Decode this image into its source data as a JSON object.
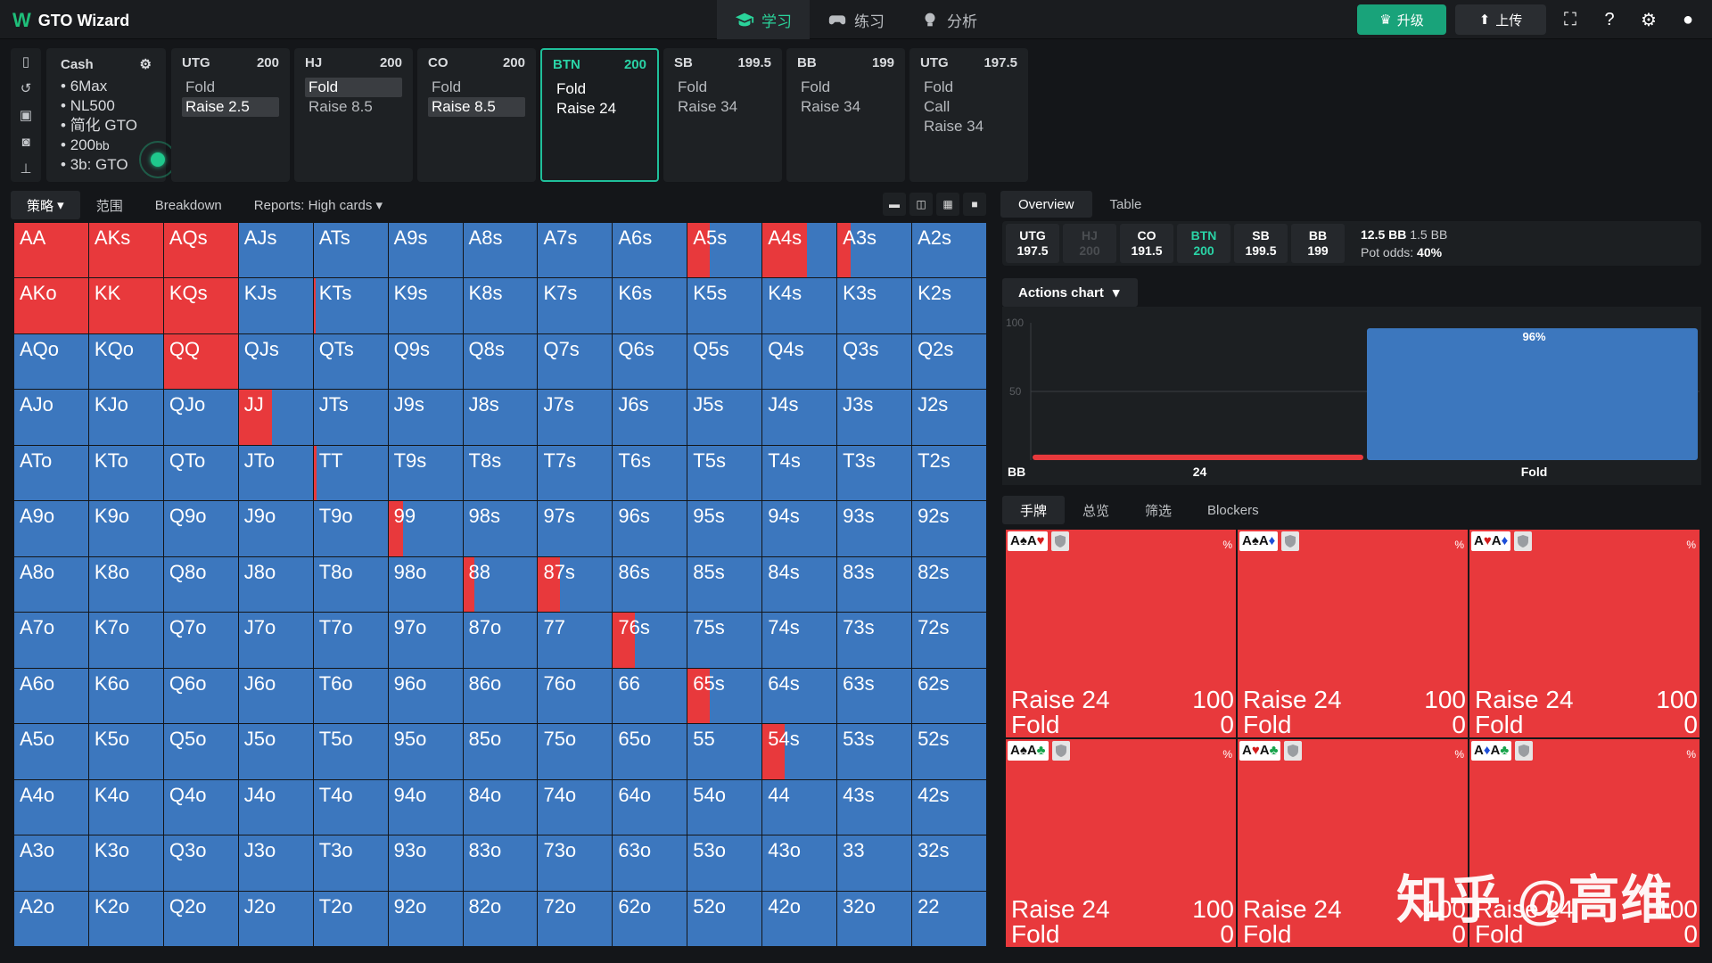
{
  "app": {
    "title": "GTO Wizard",
    "logo": "W"
  },
  "nav": [
    {
      "label": "学习",
      "icon": "graduation-cap-icon",
      "active": true
    },
    {
      "label": "练习",
      "icon": "gamepad-icon",
      "active": false
    },
    {
      "label": "分析",
      "icon": "lightbulb-icon",
      "active": false
    }
  ],
  "topright": {
    "upgrade": "升级",
    "upload": "上传"
  },
  "cash": {
    "title": "Cash",
    "items": [
      "6Max",
      "NL500",
      "简化 GTO",
      "200",
      "3b: GTO"
    ],
    "bb_suffix": "bb"
  },
  "positions": [
    {
      "name": "UTG",
      "stack": "200",
      "actions": [
        "Fold",
        "Raise 2.5"
      ],
      "selected": 1
    },
    {
      "name": "HJ",
      "stack": "200",
      "actions": [
        "Fold",
        "Raise 8.5"
      ],
      "selected": 0
    },
    {
      "name": "CO",
      "stack": "200",
      "actions": [
        "Fold",
        "Raise 8.5"
      ],
      "selected": 1
    },
    {
      "name": "BTN",
      "stack": "200",
      "actions": [
        "Fold",
        "Raise 24"
      ],
      "selected": -1,
      "active": true
    },
    {
      "name": "SB",
      "stack": "199.5",
      "actions": [
        "Fold",
        "Raise 34"
      ],
      "selected": -1
    },
    {
      "name": "BB",
      "stack": "199",
      "actions": [
        "Fold",
        "Raise 34"
      ],
      "selected": -1
    },
    {
      "name": "UTG",
      "stack": "197.5",
      "actions": [
        "Fold",
        "Call",
        "Raise 34"
      ],
      "selected": -1
    }
  ],
  "subtabs": [
    "策略",
    "范围",
    "Breakdown",
    "Reports: High cards"
  ],
  "rtabs": [
    "Overview",
    "Table"
  ],
  "stacks": [
    {
      "name": "UTG",
      "value": "197.5",
      "state": "normal"
    },
    {
      "name": "HJ",
      "value": "200",
      "state": "dim"
    },
    {
      "name": "CO",
      "value": "191.5",
      "state": "normal"
    },
    {
      "name": "BTN",
      "value": "200",
      "state": "act"
    },
    {
      "name": "SB",
      "value": "199.5",
      "state": "normal"
    },
    {
      "name": "BB",
      "value": "199",
      "state": "normal"
    }
  ],
  "pot": {
    "pot": "12.5 BB",
    "bet": "1.5 BB",
    "odds_label": "Pot odds:",
    "odds": "40%"
  },
  "actions_chart": {
    "label": "Actions chart"
  },
  "chart_data": {
    "type": "bar",
    "categories": [
      "24",
      "Fold"
    ],
    "values": [
      4,
      96
    ],
    "data_labels": [
      "",
      "96%"
    ],
    "ylim": [
      0,
      100
    ],
    "yticks": [
      "100",
      "50"
    ],
    "xprefix": "BB",
    "colors": [
      "#e8393c",
      "#3c77be"
    ]
  },
  "htabs": [
    "手牌",
    "总览",
    "筛选",
    "Blockers"
  ],
  "hands": [
    {
      "cards": [
        [
          "A",
          "♠",
          "k"
        ],
        [
          "A",
          "♥",
          "r"
        ]
      ],
      "rows": [
        [
          "Raise 24",
          "100"
        ],
        [
          "Fold",
          "0"
        ]
      ]
    },
    {
      "cards": [
        [
          "A",
          "♠",
          "k"
        ],
        [
          "A",
          "♦",
          "b"
        ]
      ],
      "rows": [
        [
          "Raise 24",
          "100"
        ],
        [
          "Fold",
          "0"
        ]
      ]
    },
    {
      "cards": [
        [
          "A",
          "♥",
          "r"
        ],
        [
          "A",
          "♦",
          "b"
        ]
      ],
      "rows": [
        [
          "Raise 24",
          "100"
        ],
        [
          "Fold",
          "0"
        ]
      ]
    },
    {
      "cards": [
        [
          "A",
          "♠",
          "k"
        ],
        [
          "A",
          "♣",
          "g"
        ]
      ],
      "rows": [
        [
          "Raise 24",
          "100"
        ],
        [
          "Fold",
          "0"
        ]
      ]
    },
    {
      "cards": [
        [
          "A",
          "♥",
          "r"
        ],
        [
          "A",
          "♣",
          "g"
        ]
      ],
      "rows": [
        [
          "Raise 24",
          "100"
        ],
        [
          "Fold",
          "0"
        ]
      ]
    },
    {
      "cards": [
        [
          "A",
          "♦",
          "b"
        ],
        [
          "A",
          "♣",
          "g"
        ]
      ],
      "rows": [
        [
          "Raise 24",
          "100"
        ],
        [
          "Fold",
          "0"
        ]
      ]
    }
  ],
  "hand_pct": "%",
  "watermark": "知乎 @高维",
  "matrix": {
    "ranks": [
      "A",
      "K",
      "Q",
      "J",
      "T",
      "9",
      "8",
      "7",
      "6",
      "5",
      "4",
      "3",
      "2"
    ],
    "raise_pct": {
      "AA": 100,
      "AKs": 100,
      "AQs": 100,
      "A5s": 30,
      "A4s": 60,
      "A3s": 18,
      "AKo": 100,
      "KK": 100,
      "KQs": 100,
      "KTs": 3,
      "QQ": 100,
      "JJ": 45,
      "TT": 4,
      "99": 20,
      "88": 15,
      "87s": 30,
      "76s": 30,
      "65s": 30,
      "54s": 30
    }
  }
}
